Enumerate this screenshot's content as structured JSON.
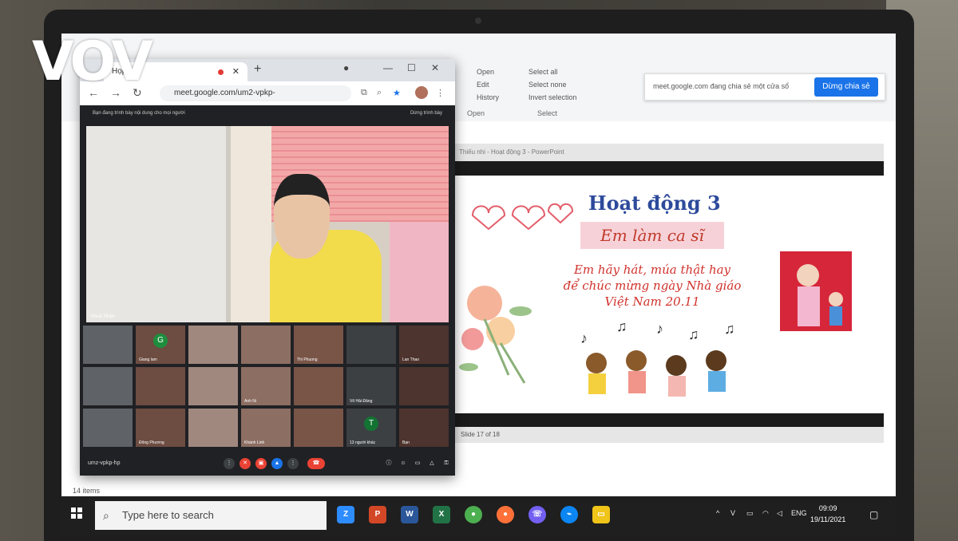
{
  "logo": {
    "text": "VOV"
  },
  "explorer": {
    "ribbon_group1": [
      "Open",
      "Edit",
      "History"
    ],
    "ribbon_group2": [
      "Select all",
      "Select none",
      "Invert selection"
    ],
    "cap_open": "Open",
    "cap_select": "Select",
    "items_count": "14 items"
  },
  "share_bar": {
    "text": "meet.google.com đang chia sẻ một cửa sổ",
    "button": "Dừng chia sẻ"
  },
  "chrome": {
    "tab_title": "Họp",
    "url": "meet.google.com/um2-vpkp-",
    "new_tab": "+"
  },
  "meet": {
    "presenting_text": "Bạn đang trình bày nội dung cho mọi người",
    "stop_text": "Dừng trình bày",
    "speaker_name": "Khuê Nhàn",
    "meeting_code": "umz-vpkp-hp",
    "tiles": [
      {
        "label": "",
        "initial": ""
      },
      {
        "label": "Giang lam",
        "initial": "G"
      },
      {
        "label": "",
        "initial": ""
      },
      {
        "label": "",
        "initial": ""
      },
      {
        "label": "Thi Phuong",
        "initial": ""
      },
      {
        "label": "",
        "initial": ""
      },
      {
        "label": "Lan Thao",
        "initial": ""
      },
      {
        "label": "",
        "initial": ""
      },
      {
        "label": "",
        "initial": ""
      },
      {
        "label": "",
        "initial": ""
      },
      {
        "label": "Anh Ni",
        "initial": ""
      },
      {
        "label": "",
        "initial": ""
      },
      {
        "label": "Võ Hải Đăng",
        "initial": ""
      },
      {
        "label": "",
        "initial": ""
      },
      {
        "label": "",
        "initial": ""
      },
      {
        "label": "Đông Phương",
        "initial": ""
      },
      {
        "label": "",
        "initial": ""
      },
      {
        "label": "Khánh Linh",
        "initial": ""
      },
      {
        "label": "",
        "initial": ""
      },
      {
        "label": "13 người khác",
        "initial": "T"
      },
      {
        "label": "Bạn",
        "initial": ""
      }
    ]
  },
  "ppt": {
    "title_bar": "Thiếu nhi - Hoạt động 3 - PowerPoint",
    "status": "Slide 17 of 18"
  },
  "slide": {
    "title": "Hoạt động 3",
    "subtitle": "Em làm ca sĩ",
    "body_line1": "Em hãy hát, múa thật hay",
    "body_line2": "để chúc mừng ngày Nhà giáo",
    "body_line3": "Việt Nam 20.11"
  },
  "taskbar": {
    "search_placeholder": "Type here to search",
    "lang": "ENG",
    "time": "09:09",
    "date": "19/11/2021"
  }
}
